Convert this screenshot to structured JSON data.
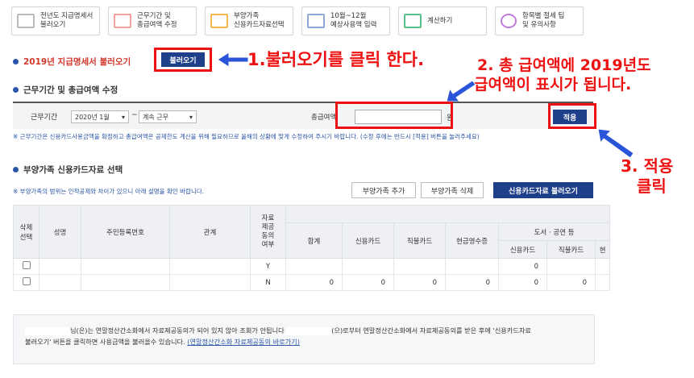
{
  "steps": [
    {
      "label": "전년도 지급명세서\n불러오기",
      "icon": "document-icon"
    },
    {
      "label": "근무기간 및\n총급여액 수정",
      "icon": "calendar-icon"
    },
    {
      "label": "부양가족\n신용카드자료선택",
      "icon": "monitor-icon"
    },
    {
      "label": "10월~12월\n예상사용액 입력",
      "icon": "card-icon"
    },
    {
      "label": "계산하기",
      "icon": "calculator-icon"
    },
    {
      "label": "항목별 절세 팁\n및 유의사항",
      "icon": "tip-icon"
    }
  ],
  "section1": {
    "title": "2019년 지급명세서 불러오기",
    "button": "불러오기"
  },
  "section2": {
    "title": "근무기간 및 총급여액 수정"
  },
  "period": {
    "label": "근무기간",
    "start": "2020년 1월",
    "end": "계속 근무",
    "tilde": "~",
    "salary_label": "총급여액",
    "salary_value": "",
    "unit": "원",
    "apply_button": "적용"
  },
  "period_note": "※ 근무기간은 신용카드사용금액을 확정하고 총급여액은 공제한도 계산을 위해 필요하므로 올해의 상황에 맞게 수정하여 주시기 바랍니다. (수정 후에는 반드시 [적용] 버튼을 눌러주세요)",
  "section3": {
    "title": "부양가족 신용카드자료 선택",
    "note": "※ 부양가족의 범위는 인적공제와 차이가 있으니 아래 설명을 확인 바랍니다.",
    "add_button": "부양가족 추가",
    "delete_button": "부양가족 삭제",
    "load_button": "신용카드자료 불러오기"
  },
  "table": {
    "headers": {
      "delete_select": "삭제\n선택",
      "name": "성명",
      "rrn": "주민등록번호",
      "relation": "관계",
      "consent": "자료\n제공\n동의\n여부",
      "total": "합계",
      "credit": "신용카드",
      "debit": "직불카드",
      "cash": "현금영수증",
      "books_group": "도서 · 공연 등",
      "books_credit": "신용카드",
      "books_debit": "직불카드",
      "books_more": "현"
    },
    "rows": [
      {
        "consent": "Y",
        "total": "",
        "credit": "",
        "debit": "",
        "cash": "",
        "b_credit": "0",
        "b_debit": ""
      },
      {
        "consent": "N",
        "total": "0",
        "credit": "0",
        "debit": "0",
        "cash": "0",
        "b_credit": "0",
        "b_debit": "0"
      }
    ]
  },
  "info": {
    "line1_a": "님(은)는 연말정산간소화에서 자료제공동의가 되어 있지 않아 조회가 안됩니다",
    "line1_b": "(으)로부터 연말정산간소화에서 자료제공동의를 받은 후에 '신용카드자료",
    "line2": "불러오기' 버튼을 클릭하면 사용금액을 불러올수 있습니다.",
    "link": "(연말정산간소화 자료제공동의 바로가기)"
  },
  "annotations": {
    "a1": "1.불러오기를 클릭 한다.",
    "a2_line1": "2. 총 급여액에 2019년도",
    "a2_line2": "급여액이 표시가 됩니다.",
    "a3_line1": "3. 적용",
    "a3_line2": "클릭"
  },
  "colors": {
    "annotation": "#ee1111",
    "primary": "#1e3f8a",
    "section_red": "#d3362b"
  }
}
